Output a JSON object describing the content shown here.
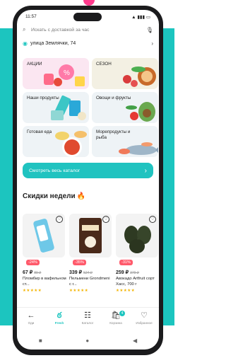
{
  "status": {
    "time": "11:57",
    "icons": "▲ ▮▮▮ ▭"
  },
  "search": {
    "placeholder": "Искать с доставкой за час"
  },
  "address": {
    "label": "улица Землячки, 74"
  },
  "categories": [
    {
      "label": "АКЦИИ"
    },
    {
      "label": "СЕЗОН"
    },
    {
      "label": "Наши продукты"
    },
    {
      "label": "Овощи и фрукты"
    },
    {
      "label": "Готовая еда"
    },
    {
      "label": "Морепродукты и рыба"
    }
  ],
  "catalog_button": {
    "label": "Смотреть весь каталог"
  },
  "deals": {
    "title": "Скидки недели",
    "products": [
      {
        "discount": "-24%",
        "price": "67 ₽",
        "old_price": "89 ₽",
        "name": "Пломбир в вафельном ст...",
        "stars": "★★★★★"
      },
      {
        "discount": "-35%",
        "price": "339 ₽",
        "old_price": "524 ₽",
        "name": "Пельмени Grondmeni с г...",
        "stars": "★★★★★"
      },
      {
        "discount": "-31%",
        "price": "259 ₽",
        "old_price": "379 ₽",
        "name": "Авокадо Artfruit сорт Хасс, 700 г",
        "stars": "★★★★★"
      }
    ]
  },
  "tabs": [
    {
      "label": "Оди"
    },
    {
      "label": "Fresh"
    },
    {
      "label": "Каталог"
    },
    {
      "label": "Корзина",
      "badge": "4"
    },
    {
      "label": "Избранное"
    }
  ]
}
